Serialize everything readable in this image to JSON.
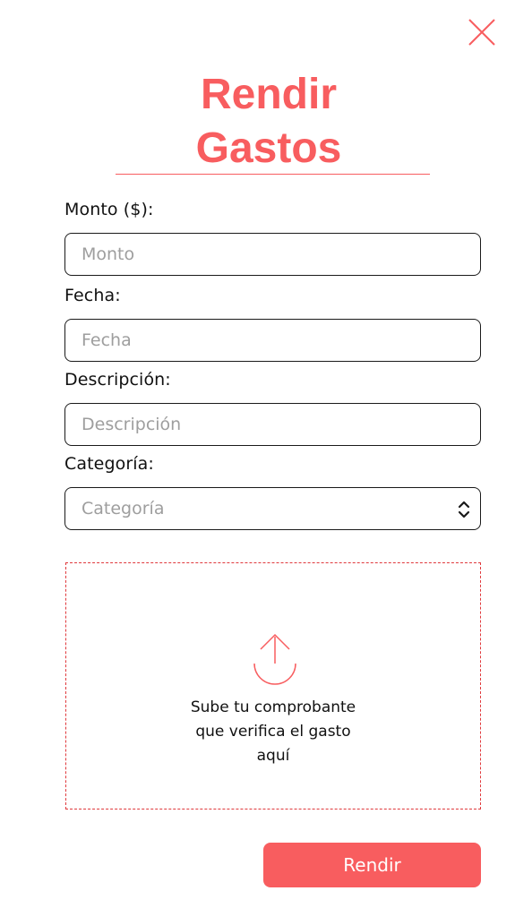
{
  "title": {
    "line1": "Rendir",
    "line2": "Gastos"
  },
  "form": {
    "monto": {
      "label": "Monto ($):",
      "placeholder": "Monto",
      "value": ""
    },
    "fecha": {
      "label": "Fecha:",
      "placeholder": "Fecha",
      "value": ""
    },
    "descripcion": {
      "label": "Descripción:",
      "placeholder": "Descripción",
      "value": ""
    },
    "categoria": {
      "label": "Categoría:",
      "selected": "Categoría"
    }
  },
  "upload": {
    "line1": "Sube tu comprobante",
    "line2": "que verifica el gasto",
    "line3": "aquí"
  },
  "submit_label": "Rendir",
  "icons": {
    "close": "close-icon",
    "select": "chevron-updown-icon",
    "upload": "upload-arrow-icon"
  },
  "colors": {
    "accent": "#f85d5f",
    "border": "#1a1a1a",
    "placeholder": "#9e9e9e"
  }
}
